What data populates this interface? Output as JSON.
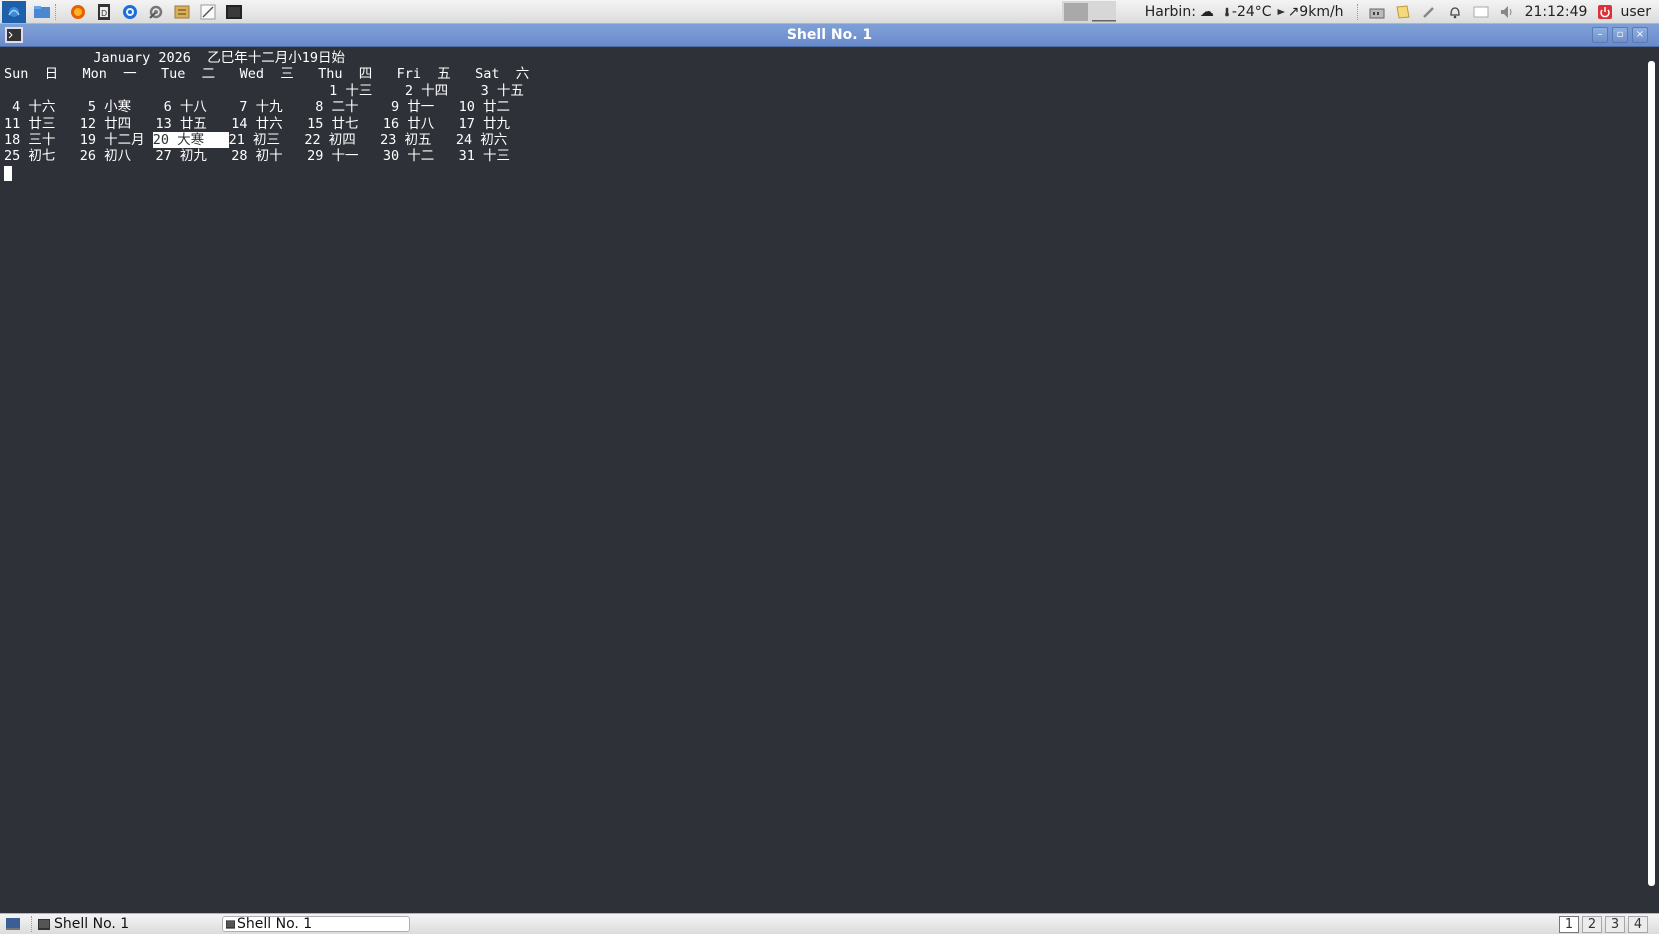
{
  "top_panel": {
    "launchers": [
      "app-menu-icon",
      "file-manager-icon",
      "firefox-icon",
      "document-icon",
      "browser-icon",
      "settings-icon",
      "archive-icon",
      "text-editor-icon",
      "terminal-icon"
    ],
    "weather": {
      "city": "Harbin:",
      "temperature": "-24°C",
      "wind": "↗9km/h"
    },
    "clock": "21:12:49",
    "user": "user"
  },
  "window": {
    "title": "Shell No. 1"
  },
  "terminal": {
    "header": "           January 2026  乙巳年十二月小19日始",
    "weekdays": "Sun  日   Mon  一   Tue  二   Wed  三   Thu  四   Fri  五   Sat  六",
    "rows": [
      "                                        1 十三    2 十四    3 十五",
      "",
      " 4 十六    5 小寒    6 十八    7 十九    8 二十    9 廿一   10 廿二",
      "11 廿三   12 廿四   13 廿五   14 廿六   15 廿七   16 廿八   17 廿九"
    ],
    "row_today_before": "18 三十   19 十二月 ",
    "row_today_cell": "20 大寒   ",
    "row_today_after": "21 初三   22 初四   23 初五   24 初六",
    "last_row": "25 初七   26 初八   27 初九   28 初十   29 十一   30 十二   31 十三"
  },
  "taskbar": {
    "tasks": [
      {
        "label": "Shell No. 1"
      },
      {
        "label": "Shell No. 1"
      }
    ],
    "workspaces": [
      "1",
      "2",
      "3",
      "4"
    ],
    "active_workspace": "1"
  },
  "colors": {
    "terminal_bg": "#2e3238",
    "title_bar": "#6a8bcb",
    "text": "#ffffff"
  }
}
